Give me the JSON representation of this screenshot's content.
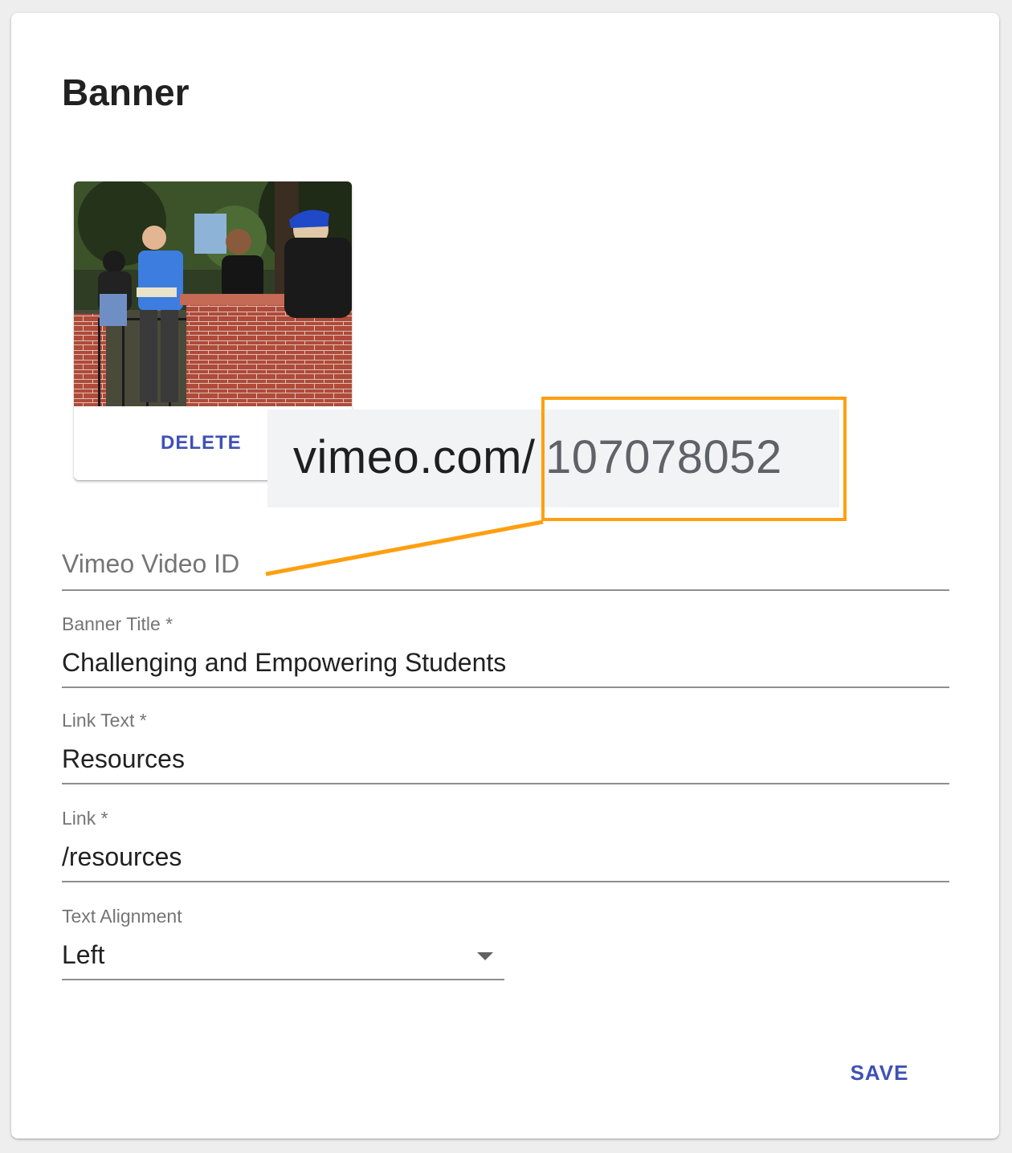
{
  "card": {
    "title": "Banner",
    "delete_label": "DELETE",
    "save_label": "SAVE"
  },
  "callout": {
    "url_domain": "vimeo.com/",
    "url_id": "107078052",
    "highlight_color": "#ff9f0f"
  },
  "fields": {
    "vimeo_id": {
      "label": "Vimeo Video ID",
      "value": ""
    },
    "banner_title": {
      "label": "Banner Title *",
      "value": "Challenging and Empowering Students"
    },
    "link_text": {
      "label": "Link Text *",
      "value": "Resources"
    },
    "link": {
      "label": "Link *",
      "value": "/resources"
    },
    "text_alignment": {
      "label": "Text Alignment",
      "value": "Left"
    }
  },
  "colors": {
    "accent": "#3f51b5",
    "callout": "#ff9f0f",
    "label": "#757575",
    "text": "#212121"
  }
}
